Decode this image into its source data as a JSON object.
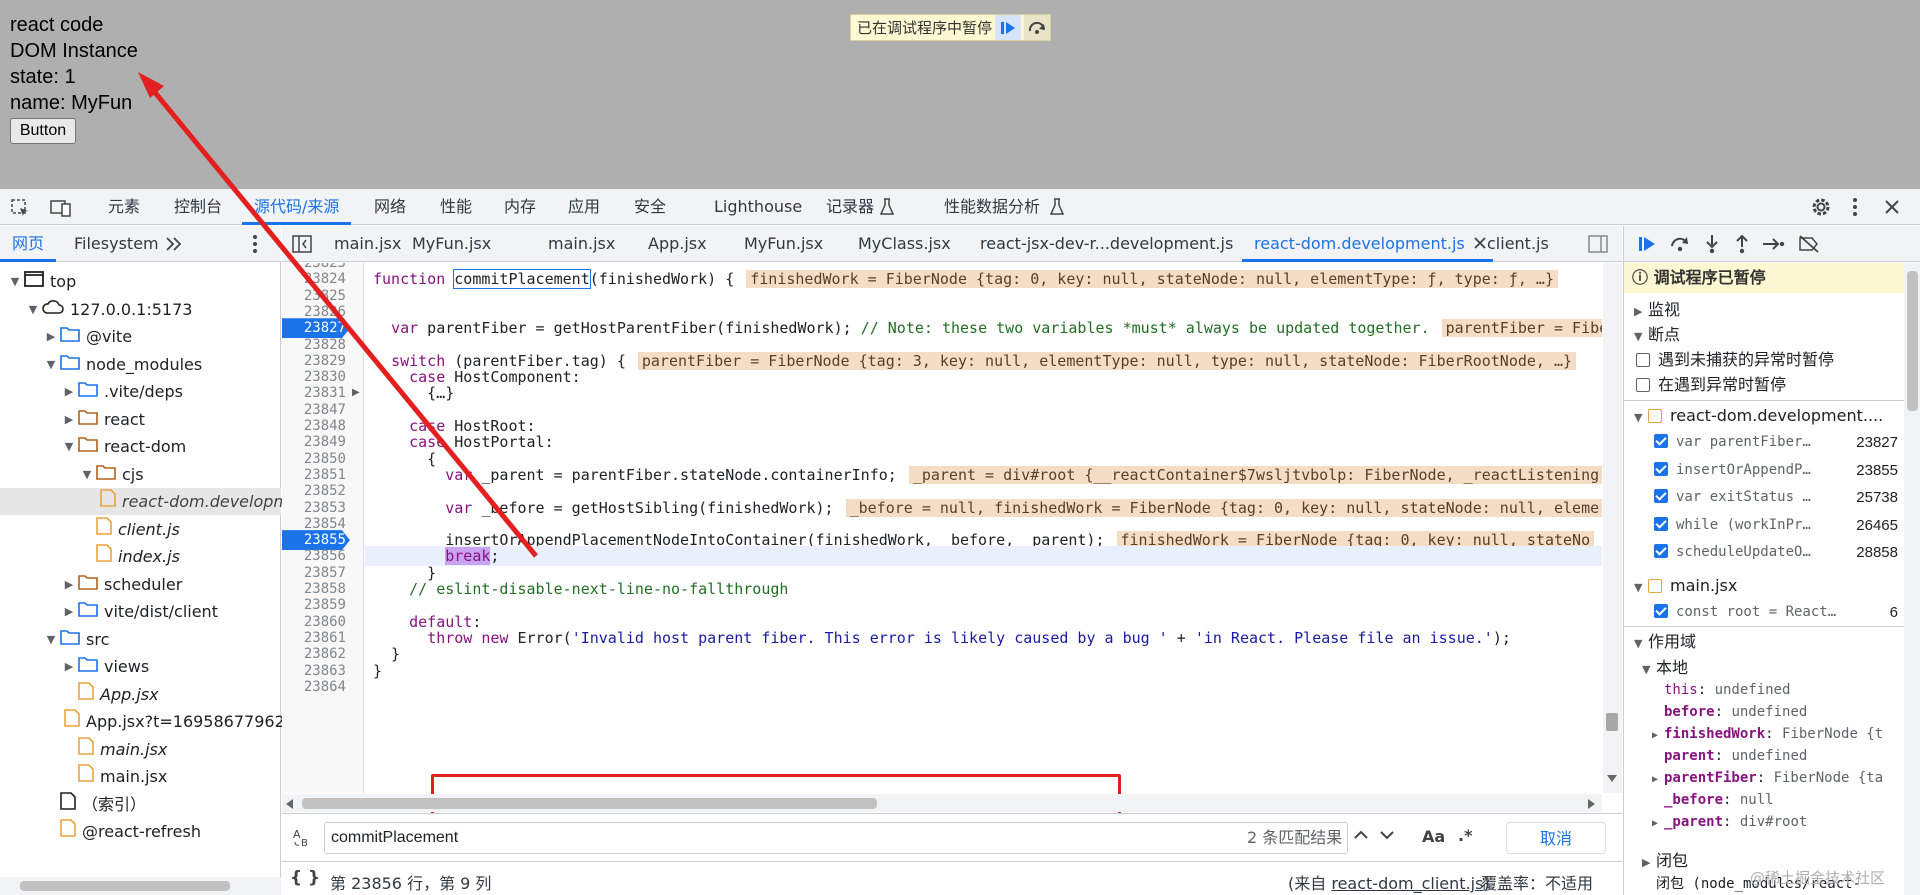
{
  "page": {
    "lines": [
      "react code",
      "DOM Instance",
      "state: 1",
      "name: MyFun"
    ],
    "button_label": "Button",
    "paused_banner": "已在调试程序中暂停"
  },
  "devtools": {
    "top_tabs": [
      "元素",
      "控制台",
      "源代码/来源",
      "网络",
      "性能",
      "内存",
      "应用",
      "安全",
      "Lighthouse",
      "记录器",
      "性能数据分析"
    ],
    "active_top_tab": "源代码/来源",
    "left_tabs": [
      "网页",
      "Filesystem"
    ],
    "tree": [
      {
        "label": "top",
        "depth": 0,
        "open": true,
        "icon": "frame"
      },
      {
        "label": "127.0.0.1:5173",
        "depth": 1,
        "open": true,
        "icon": "cloud"
      },
      {
        "label": "@vite",
        "depth": 2,
        "open": false,
        "icon": "folder-blue"
      },
      {
        "label": "node_modules",
        "depth": 2,
        "open": true,
        "icon": "folder-blue"
      },
      {
        "label": ".vite/deps",
        "depth": 3,
        "open": false,
        "icon": "folder-blue"
      },
      {
        "label": "react",
        "depth": 3,
        "open": false,
        "icon": "folder-orange"
      },
      {
        "label": "react-dom",
        "depth": 3,
        "open": true,
        "icon": "folder-orange"
      },
      {
        "label": "cjs",
        "depth": 4,
        "open": true,
        "icon": "folder-orange"
      },
      {
        "label": "react-dom.developm",
        "depth": 5,
        "icon": "file",
        "italic": true,
        "selected": true
      },
      {
        "label": "client.js",
        "depth": 4,
        "icon": "file",
        "italic": true
      },
      {
        "label": "index.js",
        "depth": 4,
        "icon": "file",
        "italic": true
      },
      {
        "label": "scheduler",
        "depth": 3,
        "open": false,
        "icon": "folder-orange"
      },
      {
        "label": "vite/dist/client",
        "depth": 3,
        "open": false,
        "icon": "folder-blue"
      },
      {
        "label": "src",
        "depth": 2,
        "open": true,
        "icon": "folder-blue"
      },
      {
        "label": "views",
        "depth": 3,
        "open": false,
        "icon": "folder-blue"
      },
      {
        "label": "App.jsx",
        "depth": 3,
        "icon": "file",
        "italic": true
      },
      {
        "label": "App.jsx?t=16958677962",
        "depth": 3,
        "icon": "file"
      },
      {
        "label": "main.jsx",
        "depth": 3,
        "icon": "file",
        "italic": true
      },
      {
        "label": "main.jsx",
        "depth": 3,
        "icon": "file"
      },
      {
        "label": "（索引）",
        "depth": 2,
        "icon": "file-doc"
      },
      {
        "label": "@react-refresh",
        "depth": 2,
        "icon": "file"
      }
    ],
    "editor_tabs": [
      "main.jsx",
      "MyFun.jsx",
      "main.jsx",
      "App.jsx",
      "MyFun.jsx",
      "MyClass.jsx",
      "react-jsx-dev-r...development.js",
      "react-dom.development.js",
      "client.js"
    ],
    "active_editor_tab": "react-dom.development.js",
    "code_lines": [
      {
        "n": "23823",
        "text": ""
      },
      {
        "n": "23824",
        "text": "function commitPlacement(finishedWork) {",
        "inline": "finishedWork = FiberNode {tag: 0, key: null, stateNode: null, elementType: ƒ, type: ƒ, …}"
      },
      {
        "n": "23825",
        "text": ""
      },
      {
        "n": "23826",
        "text": ""
      },
      {
        "n": "23827",
        "text": "  var parentFiber = getHostParentFiber(finishedWork); // Note: these two variables *must* always be updated together.",
        "inline": "parentFiber = FiberNode",
        "bp": true
      },
      {
        "n": "23828",
        "text": ""
      },
      {
        "n": "23829",
        "text": "  switch (parentFiber.tag) {",
        "inline": "parentFiber = FiberNode {tag: 3, key: null, elementType: null, type: null, stateNode: FiberRootNode, …}"
      },
      {
        "n": "23830",
        "text": "    case HostComponent:"
      },
      {
        "n": "23831",
        "text": "      {…}"
      },
      {
        "n": "23847",
        "text": ""
      },
      {
        "n": "23848",
        "text": "    case HostRoot:"
      },
      {
        "n": "23849",
        "text": "    case HostPortal:"
      },
      {
        "n": "23850",
        "text": "      {"
      },
      {
        "n": "23851",
        "text": "        var _parent = parentFiber.stateNode.containerInfo;",
        "inline": "_parent = div#root {__reactContainer$7wsljtvbolp: FiberNode, _reactListening"
      },
      {
        "n": "23852",
        "text": ""
      },
      {
        "n": "23853",
        "text": "        var _before = getHostSibling(finishedWork);",
        "inline": "_before = null, finishedWork = FiberNode {tag: 0, key: null, stateNode: null, eleme"
      },
      {
        "n": "23854",
        "text": ""
      },
      {
        "n": "23855",
        "text": "        insertOrAppendPlacementNodeIntoContainer(finishedWork, _before, _parent);",
        "inline": "finishedWork = FiberNode {tag: 0, key: null, stateNo",
        "bp": true
      },
      {
        "n": "23856",
        "text": "        break;",
        "current": true
      },
      {
        "n": "23857",
        "text": "      }"
      },
      {
        "n": "23858",
        "text": "    // eslint-disable-next-line-no-fallthrough"
      },
      {
        "n": "23859",
        "text": ""
      },
      {
        "n": "23860",
        "text": "    default:"
      },
      {
        "n": "23861",
        "text": "      throw new Error('Invalid host parent fiber. This error is likely caused by a bug ' + 'in React. Please file an issue.');"
      },
      {
        "n": "23862",
        "text": "  }"
      },
      {
        "n": "23863",
        "text": "}"
      },
      {
        "n": "23864",
        "text": ""
      }
    ],
    "search": {
      "value": "commitPlacement",
      "matches": "2 条匹配结果",
      "case_label": "Aa",
      "regex_label": ".*",
      "cancel": "取消"
    },
    "status": {
      "position": "第 23856 行，第 9 列",
      "from_prefix": "(来自 ",
      "from_link": "react-dom_client.js",
      "from_suffix": ")",
      "coverage": "覆盖率：不适用"
    },
    "right": {
      "paused": "调试程序已暂停",
      "watch": "监视",
      "breakpoints": "断点",
      "pause_uncaught": "遇到未捕获的异常时暂停",
      "pause_caught": "在遇到异常时暂停",
      "bp_file1": "react-dom.development....",
      "bp_list1": [
        {
          "code": "var parentFiber…",
          "line": "23827"
        },
        {
          "code": "insertOrAppendP…",
          "line": "23855"
        },
        {
          "code": "var exitStatus …",
          "line": "25738"
        },
        {
          "code": "while (workInPr…",
          "line": "26465"
        },
        {
          "code": "scheduleUpdateO…",
          "line": "28858"
        }
      ],
      "bp_file2": "main.jsx",
      "bp_list2": [
        {
          "code": "const root = React…",
          "line": "6"
        }
      ],
      "scope": "作用域",
      "local": "本地",
      "scope_vars": [
        {
          "k": "this",
          "v": "undefined",
          "bold": false,
          "exp": false
        },
        {
          "k": "before",
          "v": "undefined",
          "bold": true,
          "exp": false
        },
        {
          "k": "finishedWork",
          "v": "FiberNode {t",
          "bold": true,
          "exp": true
        },
        {
          "k": "parent",
          "v": "undefined",
          "bold": true,
          "exp": false
        },
        {
          "k": "parentFiber",
          "v": "FiberNode {ta",
          "bold": true,
          "exp": true
        },
        {
          "k": "_before",
          "v": "null",
          "bold": true,
          "exp": false
        },
        {
          "k": "_parent",
          "v": "div#root",
          "bold": true,
          "exp": true
        }
      ],
      "closure": "闭包",
      "closure2": "闭包 (node_modules/react-"
    },
    "watermark": "@稀土掘金技术社区",
    "colors": {
      "accent": "#1a73e8",
      "annotation": "#e31f1f",
      "page_bg": "#afafaf"
    }
  }
}
